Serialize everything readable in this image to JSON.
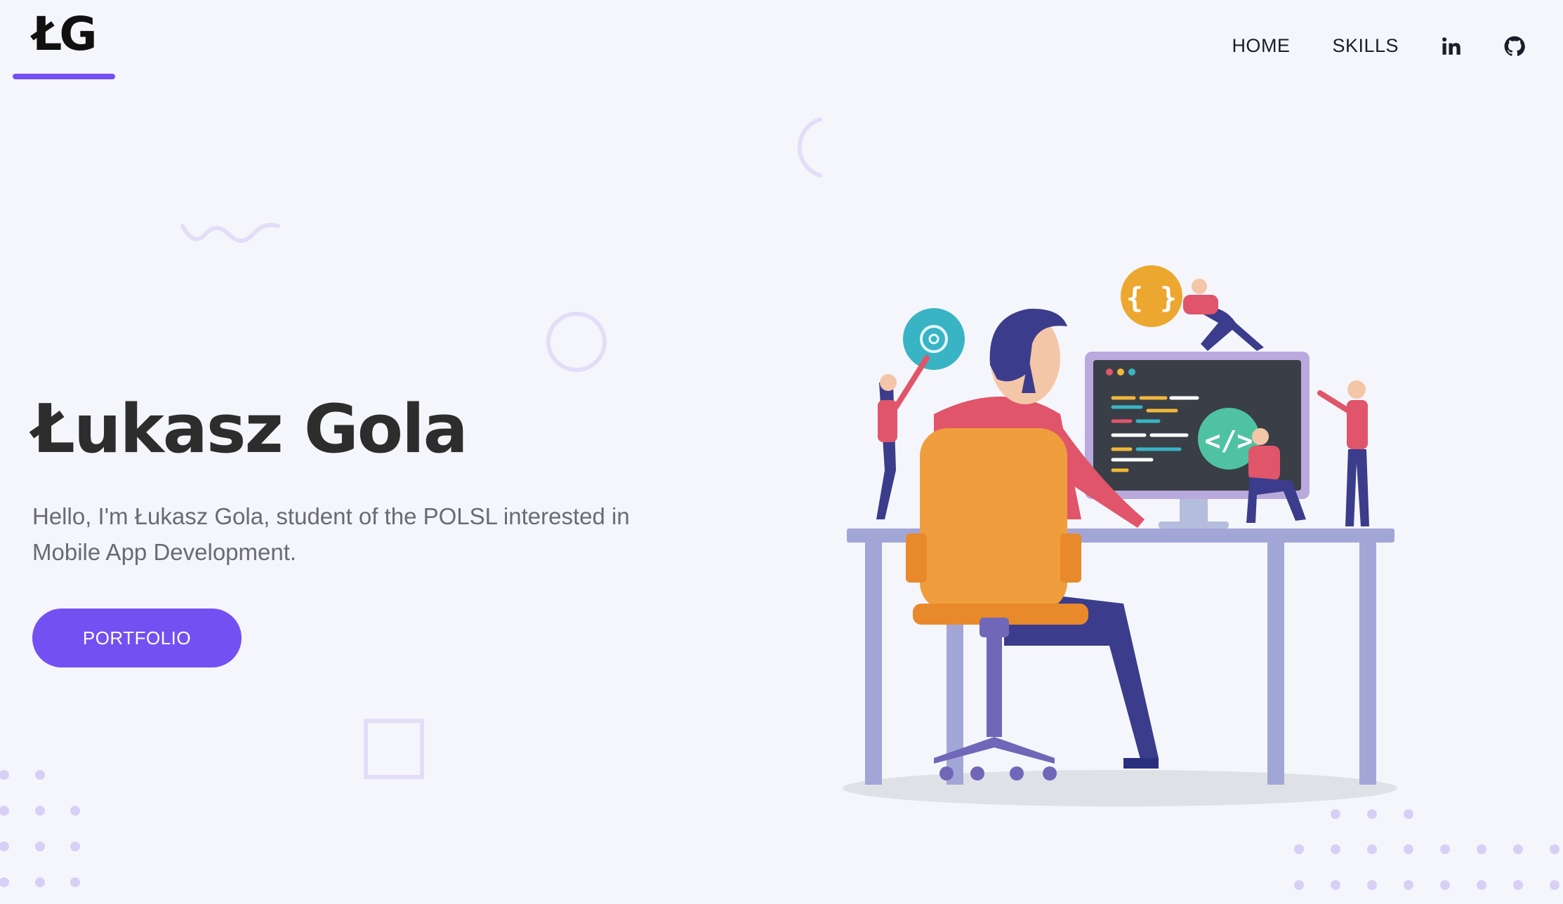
{
  "header": {
    "logo": "ŁG",
    "nav": {
      "home_label": "HOME",
      "skills_label": "SKILLS"
    },
    "icons": {
      "linkedin": "linkedin-icon",
      "github": "github-icon"
    }
  },
  "hero": {
    "title": "Łukasz Gola",
    "subtitle": "Hello, I'm Łukasz Gola, student of the POLSL interested in Mobile App Development.",
    "cta_label": "PORTFOLIO"
  },
  "colors": {
    "accent": "#7350f2",
    "background": "#f5f6fb",
    "decoration": "#e3ddf8",
    "dots": "#d8cff6"
  }
}
